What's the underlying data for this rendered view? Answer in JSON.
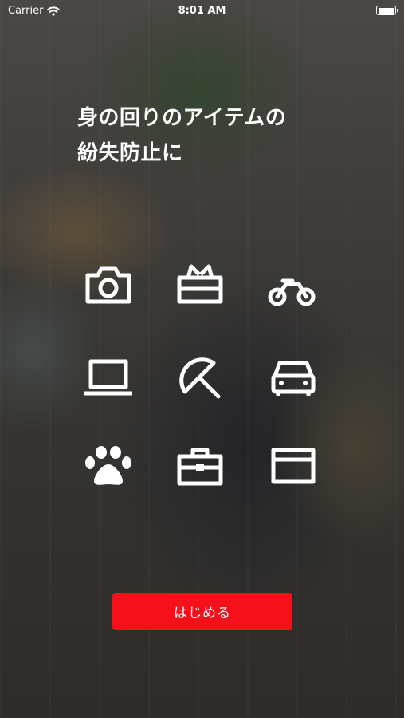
{
  "status_bar": {
    "carrier": "Carrier",
    "time": "8:01 AM",
    "icons": [
      "wifi-icon",
      "battery-icon"
    ]
  },
  "headline": {
    "line1": "身の回りのアイテムの",
    "line2": "紛失防止に"
  },
  "item_icons": [
    "camera-icon",
    "gift-icon",
    "bicycle-icon",
    "laptop-icon",
    "umbrella-icon",
    "car-icon",
    "paw-icon",
    "briefcase-icon",
    "card-icon"
  ],
  "start_button": {
    "label": "はじめる"
  },
  "colors": {
    "accent": "#f5111a",
    "text": "#ffffff"
  }
}
